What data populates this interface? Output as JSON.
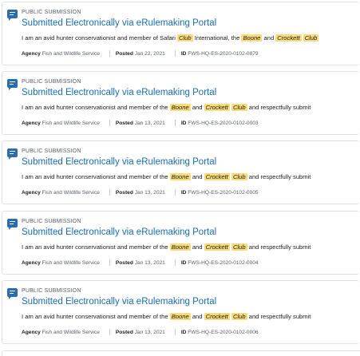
{
  "results": [
    {
      "type": "PUBLIC SUBMISSION",
      "title": "Submitted Electronically via eRulemaking Portal",
      "snippet": [
        {
          "t": "I am an avid hunter conservationist and member of Safari ",
          "hl": false
        },
        {
          "t": "Club",
          "hl": true
        },
        {
          "t": " International, the ",
          "hl": false
        },
        {
          "t": "Boone",
          "hl": true
        },
        {
          "t": " and ",
          "hl": false
        },
        {
          "t": "Crockett",
          "hl": true
        },
        {
          "t": " ",
          "hl": false
        },
        {
          "t": "Club",
          "hl": true
        }
      ],
      "agency_label": "Agency",
      "agency": "Fish and Wildlife Service",
      "posted_label": "Posted",
      "posted": "Jan 22, 2021",
      "id_label": "ID",
      "id": "FWS-HQ-ES-2020-0102-0879"
    },
    {
      "type": "PUBLIC SUBMISSION",
      "title": "Submitted Electronically via eRulemaking Portal",
      "snippet": [
        {
          "t": "I am an avid hunter conservationist and member of the ",
          "hl": false
        },
        {
          "t": "Boone",
          "hl": true
        },
        {
          "t": " and ",
          "hl": false
        },
        {
          "t": "Crockett",
          "hl": true
        },
        {
          "t": " ",
          "hl": false
        },
        {
          "t": "Club",
          "hl": true
        },
        {
          "t": " and respectfully submit",
          "hl": false
        }
      ],
      "agency_label": "Agency",
      "agency": "Fish and Wildlife Service",
      "posted_label": "Posted",
      "posted": "Jan 13, 2021",
      "id_label": "ID",
      "id": "FWS-HQ-ES-2020-0102-0003"
    },
    {
      "type": "PUBLIC SUBMISSION",
      "title": "Submitted Electronically via eRulemaking Portal",
      "snippet": [
        {
          "t": "I am an avid hunter conservationist and member of the ",
          "hl": false
        },
        {
          "t": "Boone",
          "hl": true
        },
        {
          "t": " and ",
          "hl": false
        },
        {
          "t": "Crockett",
          "hl": true
        },
        {
          "t": " ",
          "hl": false
        },
        {
          "t": "Club",
          "hl": true
        },
        {
          "t": " and respectfully submit",
          "hl": false
        }
      ],
      "agency_label": "Agency",
      "agency": "Fish and Wildlife Service",
      "posted_label": "Posted",
      "posted": "Jan 13, 2021",
      "id_label": "ID",
      "id": "FWS-HQ-ES-2020-0102-0005"
    },
    {
      "type": "PUBLIC SUBMISSION",
      "title": "Submitted Electronically via eRulemaking Portal",
      "snippet": [
        {
          "t": "I am an avid hunter conservationist and member of the ",
          "hl": false
        },
        {
          "t": "Boone",
          "hl": true
        },
        {
          "t": " and ",
          "hl": false
        },
        {
          "t": "Crockett",
          "hl": true
        },
        {
          "t": " ",
          "hl": false
        },
        {
          "t": "Club",
          "hl": true
        },
        {
          "t": " and respectfully submit",
          "hl": false
        }
      ],
      "agency_label": "Agency",
      "agency": "Fish and Wildlife Service",
      "posted_label": "Posted",
      "posted": "Jan 13, 2021",
      "id_label": "ID",
      "id": "FWS-HQ-ES-2020-0102-0004"
    },
    {
      "type": "PUBLIC SUBMISSION",
      "title": "Submitted Electronically via eRulemaking Portal",
      "snippet": [
        {
          "t": "I am an avid hunter conservationist and member of the ",
          "hl": false
        },
        {
          "t": "Boone",
          "hl": true
        },
        {
          "t": " and ",
          "hl": false
        },
        {
          "t": "Crockett",
          "hl": true
        },
        {
          "t": " ",
          "hl": false
        },
        {
          "t": "Club",
          "hl": true
        },
        {
          "t": " and respectfully submit",
          "hl": false
        }
      ],
      "agency_label": "Agency",
      "agency": "Fish and Wildlife Service",
      "posted_label": "Posted",
      "posted": "Jan 13, 2021",
      "id_label": "ID",
      "id": "FWS-HQ-ES-2020-0102-0006"
    }
  ],
  "icon": "comment-icon",
  "colors": {
    "title_link": "#1a6cb0",
    "icon": "#2b6cb0",
    "highlight": "#f8dc7c",
    "border": "#dfe1e2"
  }
}
